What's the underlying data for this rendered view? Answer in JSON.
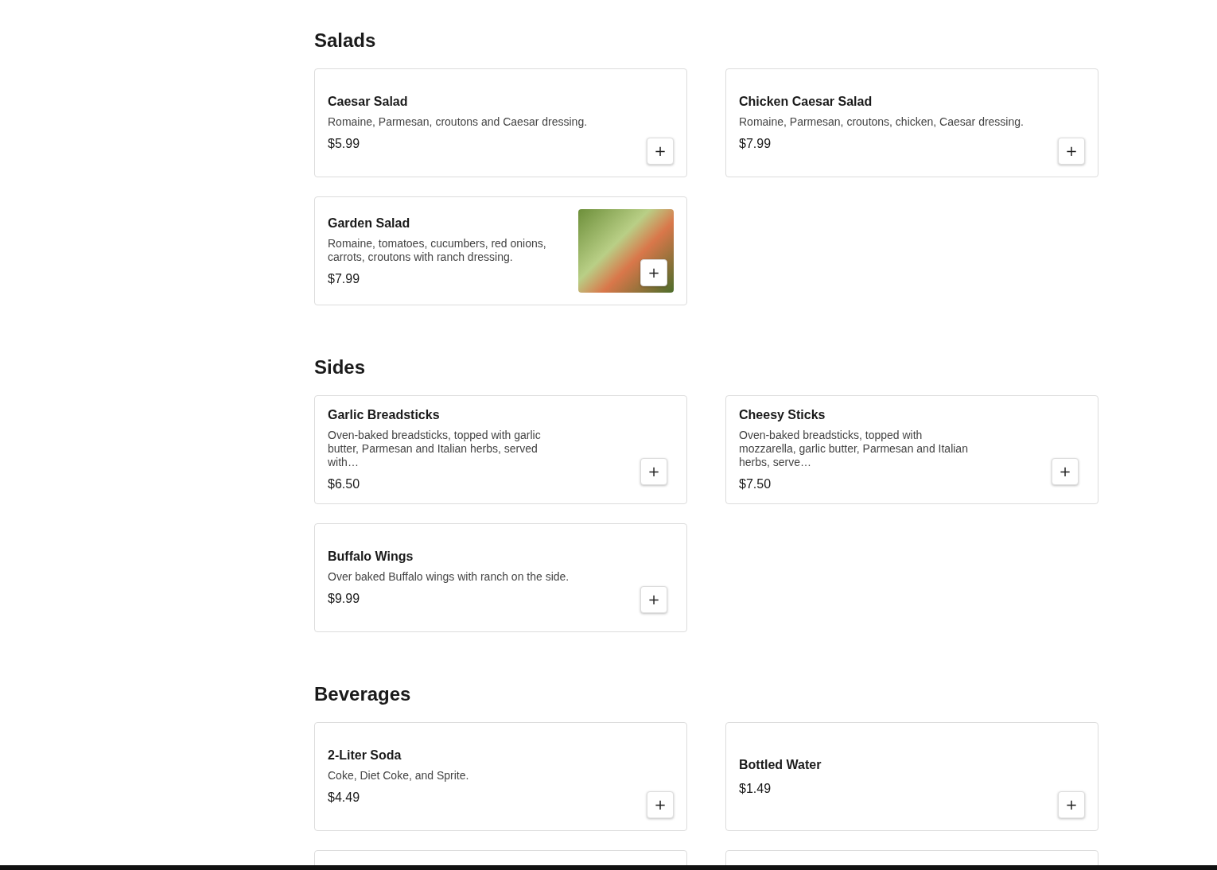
{
  "sections": [
    {
      "title": "Salads",
      "items": [
        {
          "kind": "plain",
          "name": "Caesar Salad",
          "description": "Romaine, Parmesan, croutons and Caesar dressing.",
          "price": "$5.99",
          "add": "+"
        },
        {
          "kind": "plain",
          "name": "Chicken Caesar Salad",
          "description": "Romaine, Parmesan, croutons, chicken, Caesar dressing.",
          "price": "$7.99",
          "add": "+"
        },
        {
          "kind": "photo",
          "name": "Garden Salad",
          "description": "Romaine, tomatoes, cucumbers, red onions, carrots, croutons with ranch dressing.",
          "price": "$7.99",
          "add": "+"
        }
      ]
    },
    {
      "title": "Sides",
      "items": [
        {
          "kind": "narrow",
          "name": "Garlic Breadsticks",
          "description": "Oven-baked breadsticks, topped with garlic butter, Parmesan and Italian herbs, served with…",
          "price": "$6.50",
          "add": "+"
        },
        {
          "kind": "narrow",
          "name": "Cheesy Sticks",
          "description": "Oven-baked breadsticks, topped with mozzarella, garlic butter, Parmesan and Italian herbs, serve…",
          "price": "$7.50",
          "add": "+"
        },
        {
          "kind": "narrow",
          "name": "Buffalo Wings",
          "description": "Over baked Buffalo wings with ranch on the side.",
          "price": "$9.99",
          "add": "+"
        }
      ]
    },
    {
      "title": "Beverages",
      "items": [
        {
          "kind": "plain",
          "name": "2-Liter Soda",
          "description": "Coke, Diet Coke, and Sprite.",
          "price": "$4.49",
          "add": "+"
        },
        {
          "kind": "plain",
          "name": "Bottled Water",
          "price": "$1.49",
          "add": "+"
        },
        {
          "kind": "cut_off"
        },
        {
          "kind": "cut_off"
        }
      ]
    }
  ]
}
